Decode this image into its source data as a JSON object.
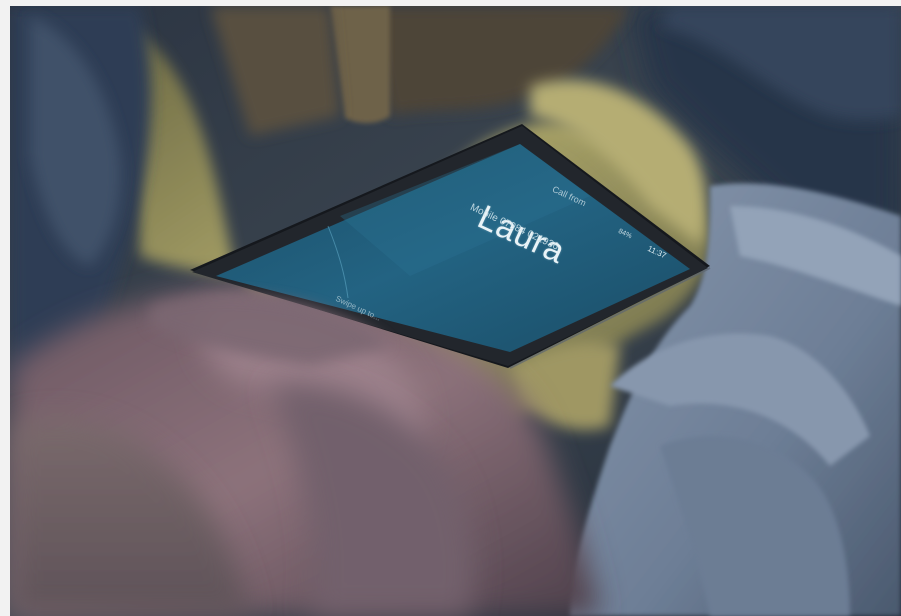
{
  "phone": {
    "call_status": "Call from",
    "caller_name": "Laura",
    "caller_number": "Mobile 07984 021936",
    "status_time": "11:37",
    "status_battery": "84%",
    "swipe_hint": "Swipe up to..."
  },
  "colors": {
    "screen": "#1f5a78",
    "phone_body": "#1a1d22",
    "blanket_grey": "#7d8fa6",
    "yellow_fabric": "#a9a162",
    "pink_fabric": "#8a6f78"
  }
}
